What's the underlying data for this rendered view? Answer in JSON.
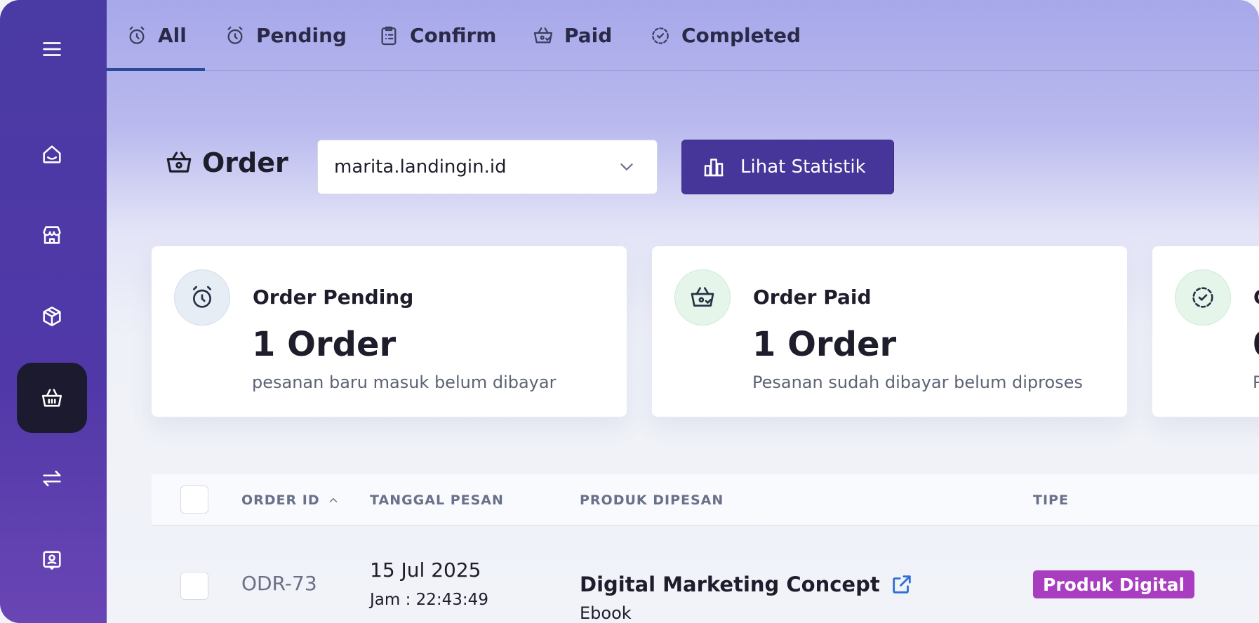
{
  "tabs": [
    {
      "label": "All",
      "icon": "alarm-clock-icon",
      "active": true
    },
    {
      "label": "Pending",
      "icon": "alarm-clock-icon"
    },
    {
      "label": "Confirm",
      "icon": "clipboard-list-icon"
    },
    {
      "label": "Paid",
      "icon": "basket-check-icon"
    },
    {
      "label": "Completed",
      "icon": "dashed-circle-check-icon"
    }
  ],
  "sidebar": {
    "items": [
      {
        "icon": "menu-icon"
      },
      {
        "icon": "home-icon"
      },
      {
        "icon": "store-icon"
      },
      {
        "icon": "package-icon"
      },
      {
        "icon": "basket-icon",
        "active": true
      },
      {
        "icon": "transfer-arrows-icon"
      },
      {
        "icon": "contact-card-icon"
      }
    ]
  },
  "header": {
    "title": "Order",
    "shop_select_value": "marita.landingin.id",
    "stat_button_label": "Lihat Statistik"
  },
  "cards": [
    {
      "title": "Order Pending",
      "value": "1 Order",
      "desc": "pesanan baru masuk belum dibayar",
      "icon": "alarm-clock-icon",
      "icon_bg": "#e6edf5"
    },
    {
      "title": "Order Paid",
      "value": "1 Order",
      "desc": "Pesanan sudah dibayar belum diproses",
      "icon": "basket-check-icon",
      "icon_bg": "#e5f5ea"
    },
    {
      "title": "C",
      "value": "0",
      "desc": "P",
      "icon": "dashed-circle-check-icon",
      "icon_bg": "#e5f5ea"
    }
  ],
  "table": {
    "headers": [
      "ORDER ID",
      "TANGGAL PESAN",
      "PRODUK DIPESAN",
      "TIPE"
    ],
    "rows": [
      {
        "order_id": "ODR-73",
        "date": "15 Jul 2025",
        "time": "Jam : 22:43:49",
        "product": "Digital Marketing Concept",
        "product_type": "Ebook",
        "tipe": "Produk Digital"
      }
    ]
  },
  "colors": {
    "sidebar": "#4a3aa3",
    "primary_button": "#463699",
    "active_sidebar": "#1c1a2e",
    "badge": "#a93dc0",
    "tab_underline": "#2b4a9c"
  }
}
